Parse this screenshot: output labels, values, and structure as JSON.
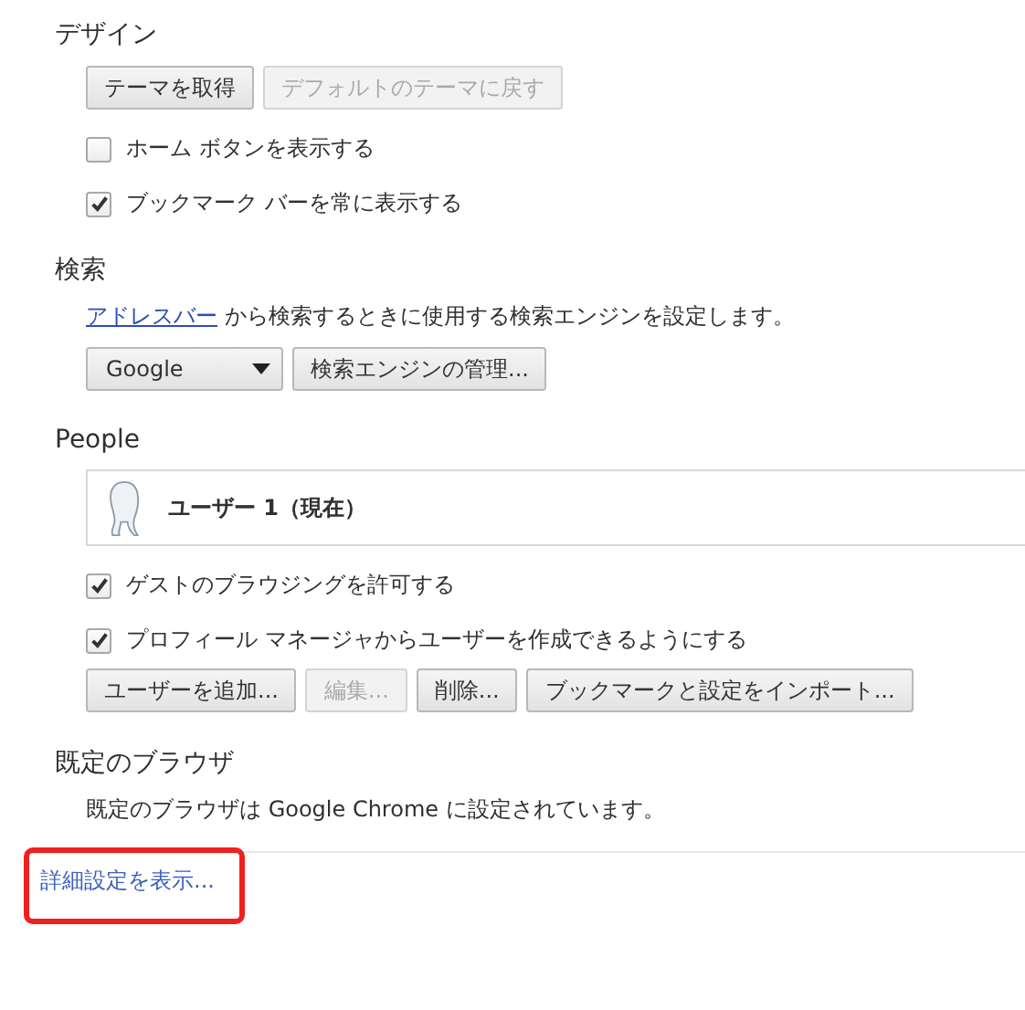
{
  "design": {
    "heading": "デザイン",
    "buttons": [
      {
        "label": "テーマを取得",
        "disabled": false
      },
      {
        "label": "デフォルトのテーマに戻す",
        "disabled": true
      }
    ],
    "options": [
      {
        "label": "ホーム ボタンを表示する",
        "checked": false
      },
      {
        "label": "ブックマーク バーを常に表示する",
        "checked": true
      }
    ]
  },
  "search": {
    "heading": "検索",
    "link": "アドレスバー",
    "sentence": "から検索するときに使用する検索エンジンを設定します。",
    "engine": "Google",
    "manage_button": "検索エンジンの管理..."
  },
  "people": {
    "heading": "People",
    "user": "ユーザー 1（現在）",
    "options": [
      {
        "label": "ゲストのブラウジングを許可する",
        "checked": true
      },
      {
        "label": "プロフィール マネージャからユーザーを作成できるようにする",
        "checked": true
      }
    ],
    "buttons": [
      {
        "label": "ユーザーを追加...",
        "disabled": false
      },
      {
        "label": "編集...",
        "disabled": true
      },
      {
        "label": "削除...",
        "disabled": false
      },
      {
        "label": "ブックマークと設定をインポート...",
        "disabled": false
      }
    ]
  },
  "default_browser": {
    "heading": "既定のブラウザ",
    "text": "既定のブラウザは Google Chrome に設定されています。"
  },
  "advanced_link": {
    "label": "詳細設定を表示...",
    "highlighted": true
  }
}
